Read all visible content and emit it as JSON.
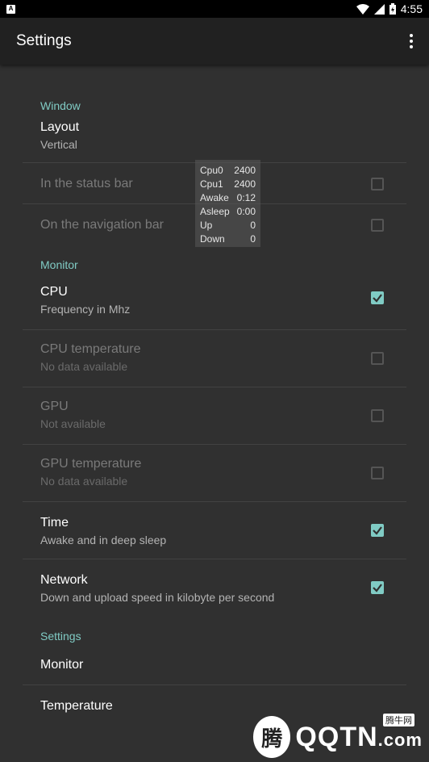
{
  "status_bar": {
    "time": "4:55",
    "icons": [
      "notification-a-icon",
      "wifi-icon",
      "signal-icon",
      "battery-icon"
    ]
  },
  "app_bar": {
    "title": "Settings",
    "menu_icon": "overflow-menu-icon"
  },
  "sections": {
    "window": {
      "header": "Window",
      "layout": {
        "title": "Layout",
        "summary": "Vertical"
      },
      "status_bar": {
        "title": "In the status bar",
        "checked": false,
        "enabled": false
      },
      "nav_bar": {
        "title": "On the navigation bar",
        "checked": false,
        "enabled": false
      }
    },
    "monitor": {
      "header": "Monitor",
      "cpu": {
        "title": "CPU",
        "summary": "Frequency in Mhz",
        "checked": true,
        "enabled": true
      },
      "cpu_temp": {
        "title": "CPU temperature",
        "summary": "No data available",
        "checked": false,
        "enabled": false
      },
      "gpu": {
        "title": "GPU",
        "summary": "Not available",
        "checked": false,
        "enabled": false
      },
      "gpu_temp": {
        "title": "GPU temperature",
        "summary": "No data available",
        "checked": false,
        "enabled": false
      },
      "time": {
        "title": "Time",
        "summary": "Awake and in deep sleep",
        "checked": true,
        "enabled": true
      },
      "network": {
        "title": "Network",
        "summary": "Down and upload speed in kilobyte per second",
        "checked": true,
        "enabled": true
      }
    },
    "settings": {
      "header": "Settings",
      "monitor": {
        "title": "Monitor"
      },
      "temperature": {
        "title": "Temperature"
      }
    }
  },
  "overlay": {
    "rows": [
      {
        "label": "Cpu0",
        "value": "2400"
      },
      {
        "label": "Cpu1",
        "value": "2400"
      },
      {
        "label": "Awake",
        "value": "0:12"
      },
      {
        "label": "Asleep",
        "value": "0:00"
      },
      {
        "label": "Up",
        "value": "0"
      },
      {
        "label": "Down",
        "value": "0"
      }
    ]
  },
  "watermark": {
    "logo_glyph": "腾",
    "brand": "QQTN",
    "suffix": ".com",
    "badge": "腾牛网"
  },
  "colors": {
    "accent": "#80cbc4",
    "background": "#303030",
    "app_bar": "#212121"
  }
}
